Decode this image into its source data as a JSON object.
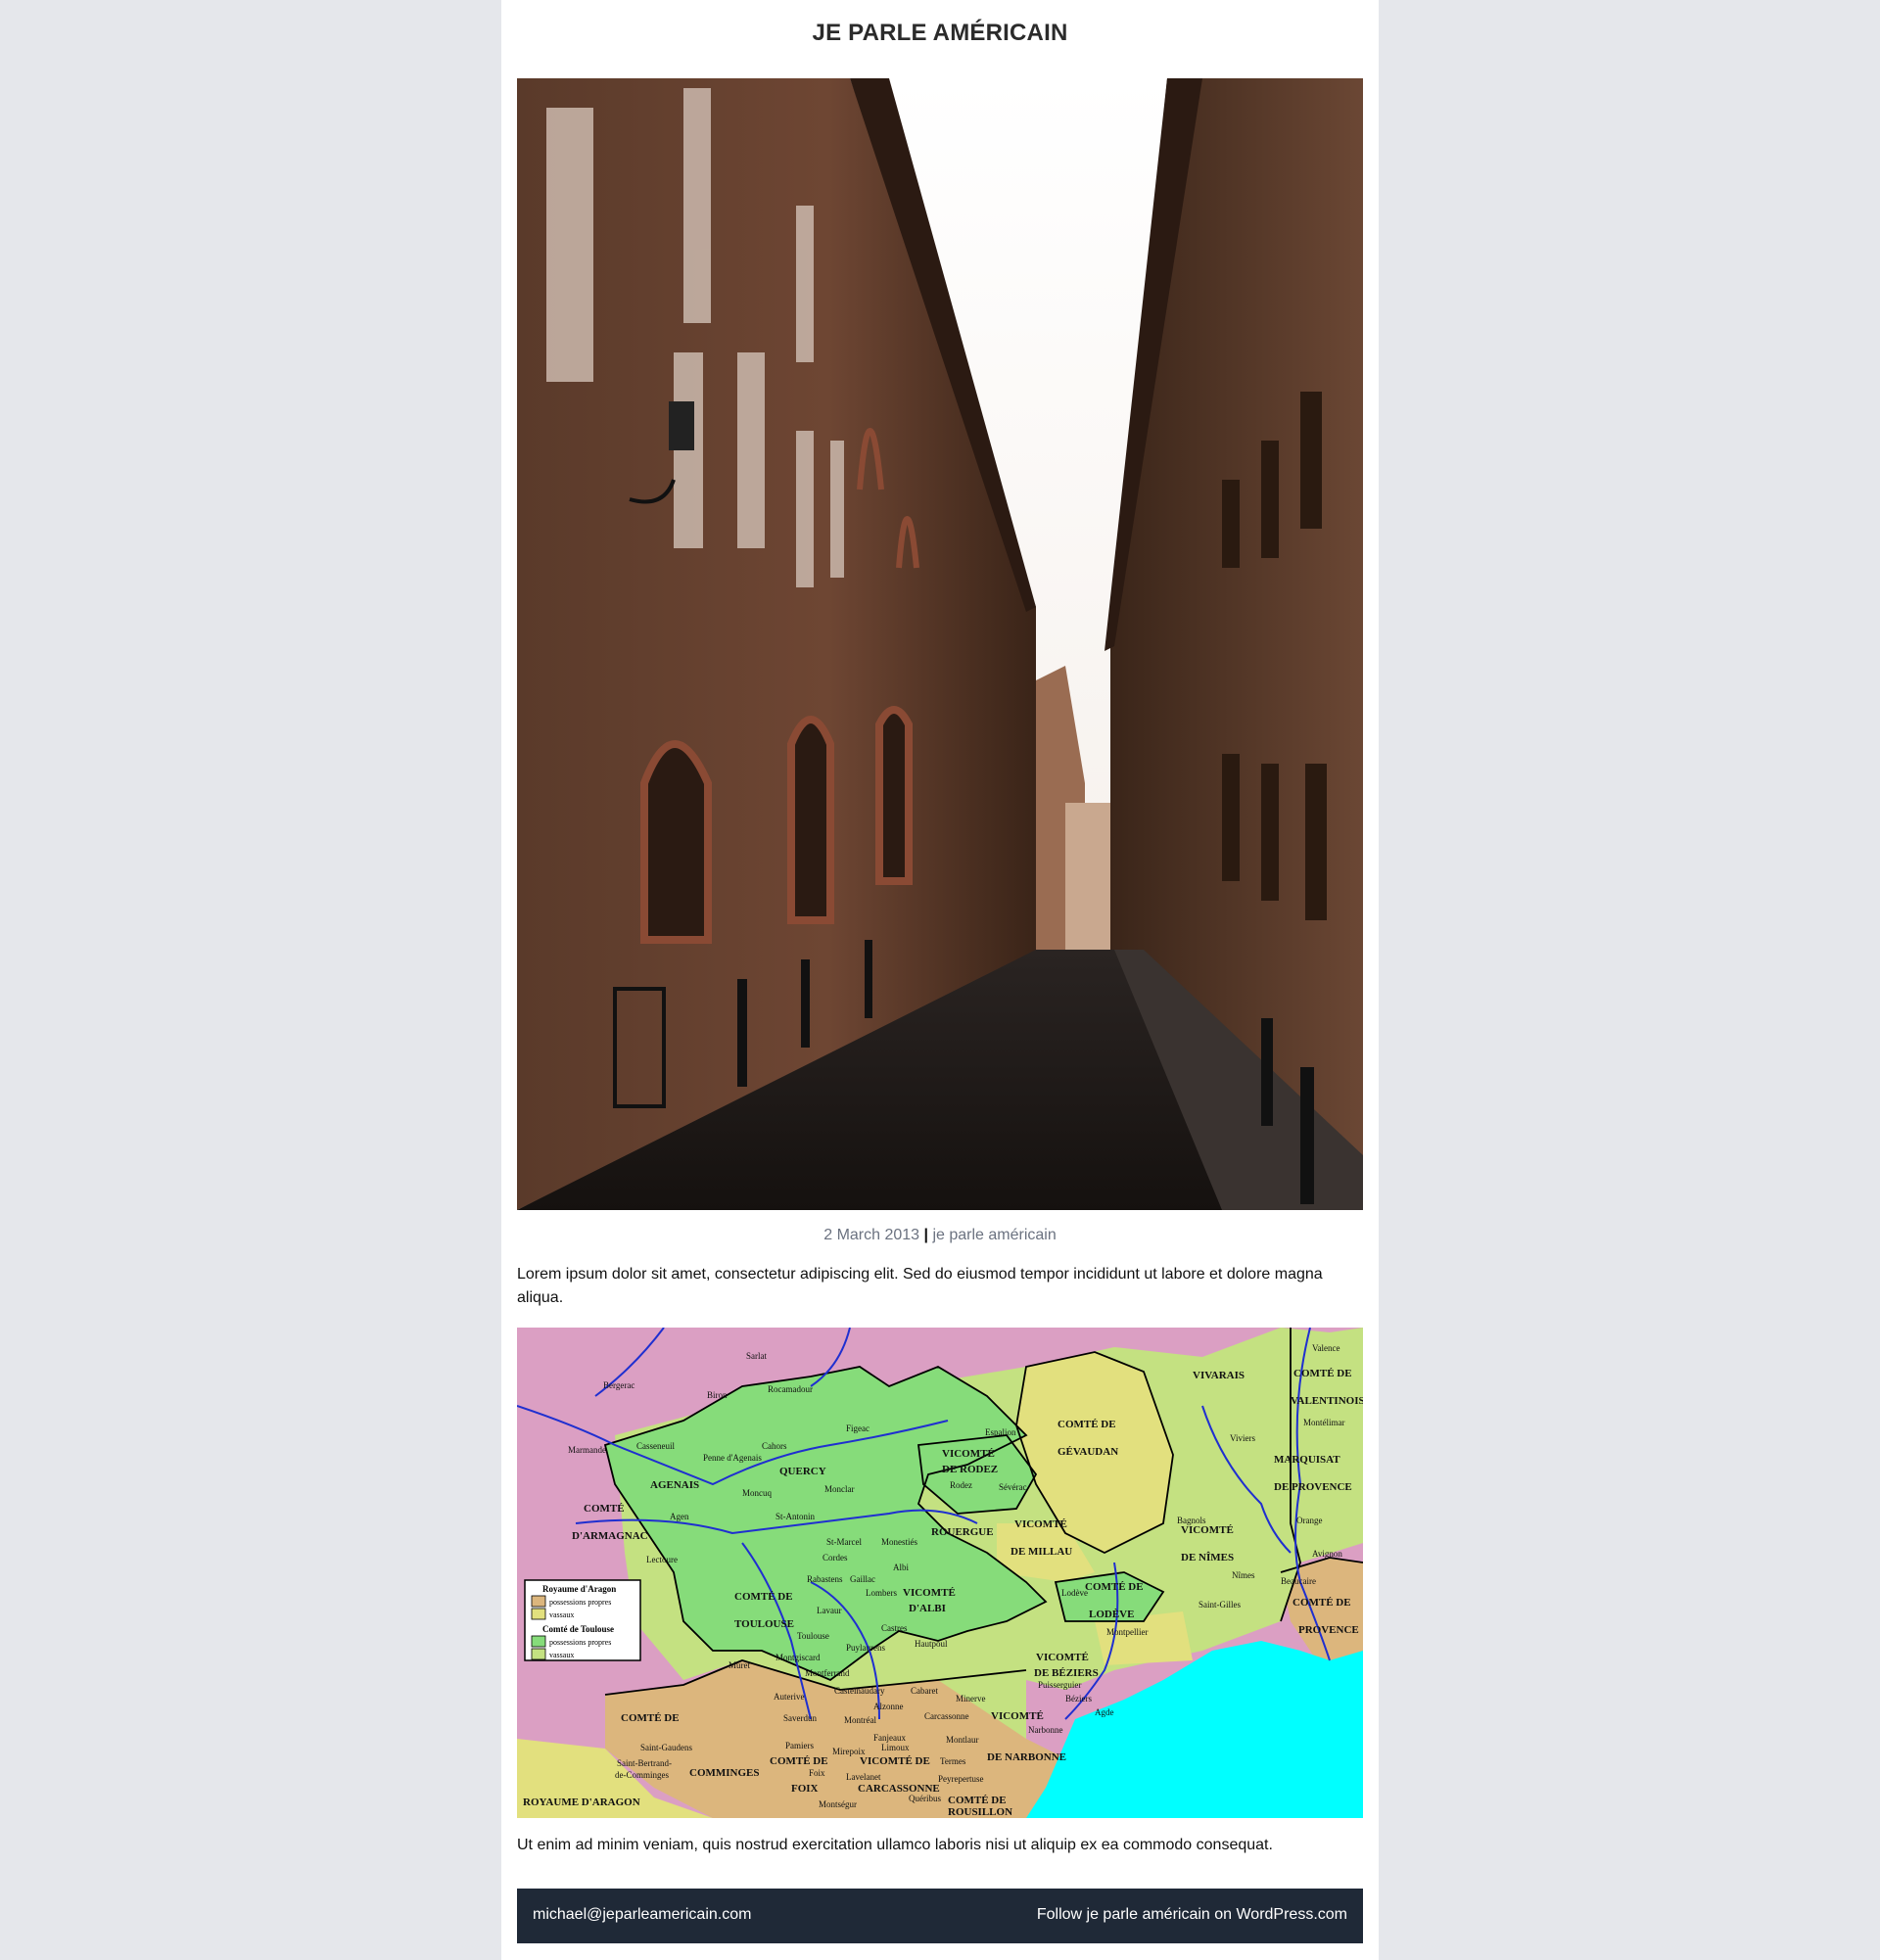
{
  "site": {
    "title": "JE PARLE AMÉRICAIN"
  },
  "post": {
    "date": "2 March 2013",
    "separator": "|",
    "category": "je parle américain",
    "paragraph1": "Lorem ipsum dolor sit amet, consectetur adipiscing elit. Sed do eiusmod tempor incididunt ut labore et dolore magna aliqua.",
    "paragraph2": "Ut enim ad minim veniam, quis nostrud exercitation ullamco laboris nisi ut aliquip ex ea commodo consequat."
  },
  "map": {
    "regions": {
      "vivarais": "VIVARAIS",
      "comte_de_valentinois_1": "COMTÉ DE",
      "comte_de_valentinois_2": "VALENTINOIS",
      "marquisat_1": "MARQUISAT",
      "marquisat_2": "DE PROVENCE",
      "comte_de_gevaudan_1": "COMTÉ DE",
      "comte_de_gevaudan_2": "GÉVAUDAN",
      "vicomte_rodez_1": "VICOMTÉ",
      "vicomte_rodez_2": "DE RODEZ",
      "quercy": "QUERCY",
      "agenais": "AGENAIS",
      "comte_armagnac_1": "COMTÉ",
      "comte_armagnac_2": "D'ARMAGNAC",
      "rouergue": "ROUERGUE",
      "vicomte_millau_1": "VICOMTÉ",
      "vicomte_millau_2": "DE MILLAU",
      "vicomte_nimes_1": "VICOMTÉ",
      "vicomte_nimes_2": "DE NÎMES",
      "comte_toulouse_1": "COMTÉ DE",
      "comte_toulouse_2": "TOULOUSE",
      "vicomte_albi_1": "VICOMTÉ",
      "vicomte_albi_2": "D'ALBI",
      "comte_lodeve_1": "COMTÉ DE",
      "comte_lodeve_2": "LODÈVE",
      "comte_provence_1": "COMTÉ DE",
      "comte_provence_2": "PROVENCE",
      "vicomte_beziers_1": "VICOMTÉ",
      "vicomte_beziers_2": "DE BÉZIERS",
      "comte_comminges_1": "COMTÉ DE",
      "comte_comminges_2": "COMMINGES",
      "vicomte_narbonne_1": "VICOMTÉ",
      "vicomte_narbonne_2": "DE NARBONNE",
      "comte_foix_1": "COMTÉ DE",
      "comte_foix_2": "FOIX",
      "vicomte_carcassonne_1": "VICOMTÉ DE",
      "vicomte_carcassonne_2": "CARCASSONNE",
      "comte_roussillon_1": "COMTÉ DE",
      "comte_roussillon_2": "ROUSILLON",
      "royaume_aragon": "ROYAUME D'ARAGON"
    },
    "cities": {
      "sarlat": "Sarlat",
      "bergerac": "Bergerac",
      "biron": "Biron",
      "rocamadour": "Rocamadour",
      "valence": "Valence",
      "montelimar": "Montélimar",
      "viviers": "Viviers",
      "figeac": "Figeac",
      "espalion": "Espalion",
      "cahors": "Cahors",
      "casseneuil": "Casseneuil",
      "marmande": "Marmande",
      "penne": "Penne d'Agenais",
      "montcuq": "Moncuq",
      "monclar": "Monclar",
      "rodez": "Rodez",
      "severac": "Sévérac",
      "montauban": "Montauban",
      "bagnols": "Bagnols",
      "agen": "Agen",
      "st_antonin": "St-Antonin",
      "orange": "Orange",
      "st_marcel": "St-Marcel",
      "monesties": "Monestiés",
      "lectoure": "Lectoure",
      "cordes": "Cordes",
      "avignon": "Avignon",
      "albi": "Albi",
      "nimes": "Nîmes",
      "rabastens": "Rabastens",
      "gaillac": "Gaillac",
      "lombers": "Lombers",
      "beaucaire": "Beaucaire",
      "lodeve": "Lodève",
      "st_gilles": "Saint-Gilles",
      "lavaur": "Lavaur",
      "toulouse": "Toulouse",
      "castres": "Castres",
      "montpellier": "Montpellier",
      "puylaurens": "Puylaurens",
      "hautpoul": "Hautpoul",
      "muret": "Muret",
      "montgiscard": "Montgiscard",
      "montferrand": "Montferrand",
      "beziers": "Béziers",
      "castelnaudary": "Castelnaudary",
      "cabaret": "Cabaret",
      "minerve": "Minerve",
      "puisserguier": "Puisserguier",
      "auterive": "Auterive",
      "alzonne": "Alzonne",
      "agde": "Agde",
      "saverdun": "Saverdun",
      "montreal": "Montréal",
      "carcassonne": "Carcassonne",
      "narbonne": "Narbonne",
      "pamiers": "Pamiers",
      "mirepoix": "Mirepoix",
      "fanjeaux": "Fanjeaux",
      "montlaur": "Montlaur",
      "limoux": "Limoux",
      "st_gaudens": "Saint-Gaudens",
      "st_bertrand_1": "Saint-Bertrand-",
      "st_bertrand_2": "de-Comminges",
      "termes": "Termes",
      "foix": "Foix",
      "lavelanet": "Lavelanet",
      "peyrepertuse": "Peyrepertuse",
      "montsegur": "Montségur",
      "quéribus": "Quéribus"
    },
    "legend": {
      "aragon_title": "Royaume d'Aragon",
      "aragon_own": "possessions propres",
      "aragon_vassals": "vassaux",
      "toulouse_title": "Comté de Toulouse",
      "toulouse_own": "possessions propres",
      "toulouse_vassals": "vassaux"
    },
    "colors": {
      "pink": "#db9fc3",
      "toulouse_own": "#86dc7a",
      "toulouse_vassal": "#c4e181",
      "aragon_own": "#dcb67d",
      "aragon_vassal": "#e2e07e",
      "sea": "#00ffff",
      "river": "#1f2fd0"
    }
  },
  "footer": {
    "email": "michael@jeparleamericain.com",
    "follow": "Follow je parle américain on WordPress.com"
  }
}
